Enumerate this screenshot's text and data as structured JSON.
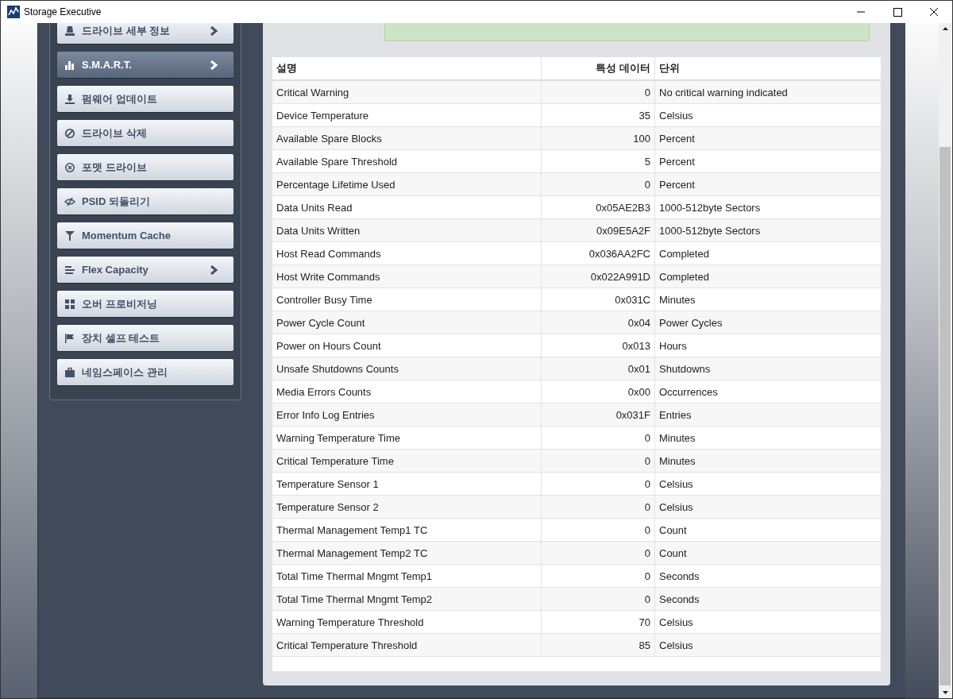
{
  "window": {
    "title": "Storage Executive"
  },
  "sidebar": {
    "items": [
      {
        "label": "드라이브 세부 정보",
        "selected": false,
        "kind": "submenu"
      },
      {
        "label": "S.M.A.R.T.",
        "selected": true,
        "kind": "submenu"
      },
      {
        "label": "펌웨어 업데이트",
        "selected": false,
        "kind": "action"
      },
      {
        "label": "드라이브 삭제",
        "selected": false,
        "kind": "action"
      },
      {
        "label": "포맷 드라이브",
        "selected": false,
        "kind": "action"
      },
      {
        "label": "PSID 되돌리기",
        "selected": false,
        "kind": "action"
      },
      {
        "label": "Momentum Cache",
        "selected": false,
        "kind": "action"
      },
      {
        "label": "Flex Capacity",
        "selected": false,
        "kind": "submenu"
      },
      {
        "label": "오버 프로비저닝",
        "selected": false,
        "kind": "action"
      },
      {
        "label": "장치 셀프 테스트",
        "selected": false,
        "kind": "action"
      },
      {
        "label": "네임스페이스 관리",
        "selected": false,
        "kind": "action"
      }
    ]
  },
  "table": {
    "columns": [
      "설명",
      "특성 데이터",
      "단위"
    ],
    "rows": [
      [
        "Critical Warning",
        "0",
        "No critical warning indicated"
      ],
      [
        "Device Temperature",
        "35",
        "Celsius"
      ],
      [
        "Available Spare Blocks",
        "100",
        "Percent"
      ],
      [
        "Available Spare Threshold",
        "5",
        "Percent"
      ],
      [
        "Percentage Lifetime Used",
        "0",
        "Percent"
      ],
      [
        "Data Units Read",
        "0x05AE2B3",
        "1000-512byte Sectors"
      ],
      [
        "Data Units Written",
        "0x09E5A2F",
        "1000-512byte Sectors"
      ],
      [
        "Host Read Commands",
        "0x036AA2FC",
        "Completed"
      ],
      [
        "Host Write Commands",
        "0x022A991D",
        "Completed"
      ],
      [
        "Controller Busy Time",
        "0x031C",
        "Minutes"
      ],
      [
        "Power Cycle Count",
        "0x04",
        "Power Cycles"
      ],
      [
        "Power on Hours Count",
        "0x013",
        "Hours"
      ],
      [
        "Unsafe Shutdowns Counts",
        "0x01",
        "Shutdowns"
      ],
      [
        "Media Errors Counts",
        "0x00",
        "Occurrences"
      ],
      [
        "Error Info Log Entries",
        "0x031F",
        "Entries"
      ],
      [
        "Warning Temperature Time",
        "0",
        "Minutes"
      ],
      [
        "Critical Temperature Time",
        "0",
        "Minutes"
      ],
      [
        "Temperature Sensor 1",
        "0",
        "Celsius"
      ],
      [
        "Temperature Sensor 2",
        "0",
        "Celsius"
      ],
      [
        "Thermal Management Temp1 TC",
        "0",
        "Count"
      ],
      [
        "Thermal Management Temp2 TC",
        "0",
        "Count"
      ],
      [
        "Total Time Thermal Mngmt Temp1",
        "0",
        "Seconds"
      ],
      [
        "Total Time Thermal Mngmt Temp2",
        "0",
        "Seconds"
      ],
      [
        "Warning Temperature Threshold",
        "70",
        "Celsius"
      ],
      [
        "Critical Temperature Threshold",
        "85",
        "Celsius"
      ]
    ]
  }
}
